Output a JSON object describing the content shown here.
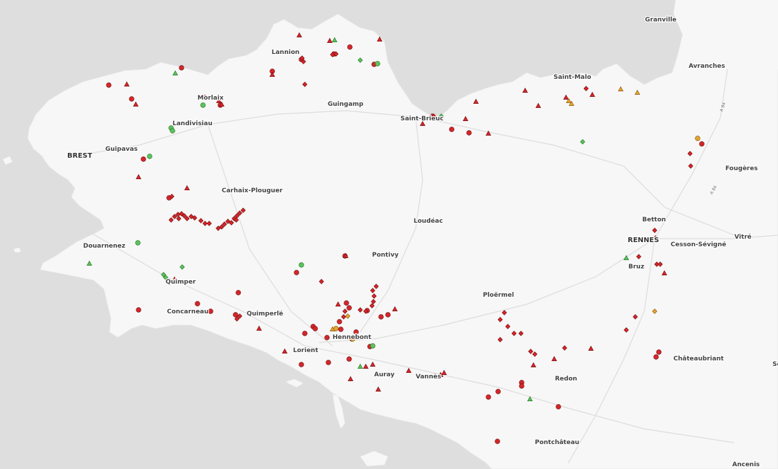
{
  "map": {
    "colors": {
      "sea": "#dedede",
      "land": "#f7f7f7",
      "marker_red": "#d7262b",
      "marker_green": "#5cc35c",
      "marker_orange": "#e6a632",
      "marker_stroke": "#7a1010"
    },
    "places": [
      {
        "name": "Granville",
        "big": false
      },
      {
        "name": "Avranches",
        "big": false
      },
      {
        "name": "Lannion",
        "big": false
      },
      {
        "name": "Saint-Malo",
        "big": false
      },
      {
        "name": "Morlaix",
        "big": false
      },
      {
        "name": "Guingamp",
        "big": false
      },
      {
        "name": "Landivisiau",
        "big": false
      },
      {
        "name": "Saint-Brieuc",
        "big": false
      },
      {
        "name": "BREST",
        "big": true
      },
      {
        "name": "Guipavas",
        "big": false
      },
      {
        "name": "Fougères",
        "big": false
      },
      {
        "name": "Carhaix-Plouguer",
        "big": false
      },
      {
        "name": "Loudéac",
        "big": false
      },
      {
        "name": "Betton",
        "big": false
      },
      {
        "name": "RENNES",
        "big": true
      },
      {
        "name": "Cesson-Sévigné",
        "big": false
      },
      {
        "name": "Vitré",
        "big": false
      },
      {
        "name": "Douarnenez",
        "big": false
      },
      {
        "name": "Pontivy",
        "big": false
      },
      {
        "name": "Bruz",
        "big": false
      },
      {
        "name": "Quimper",
        "big": false
      },
      {
        "name": "Ploërmel",
        "big": false
      },
      {
        "name": "Concarneau",
        "big": false
      },
      {
        "name": "Quimperlé",
        "big": false
      },
      {
        "name": "Hennebont",
        "big": false
      },
      {
        "name": "Lorient",
        "big": false
      },
      {
        "name": "Châteaubriant",
        "big": false
      },
      {
        "name": "Auray",
        "big": false
      },
      {
        "name": "Vannes",
        "big": false
      },
      {
        "name": "Redon",
        "big": false
      },
      {
        "name": "Pontchâteau",
        "big": false
      },
      {
        "name": "Ancenis",
        "big": false
      },
      {
        "name": "Se",
        "big": false
      }
    ],
    "road_labels": [
      "A 84",
      "A 84"
    ],
    "markers": {
      "red_circles": 48,
      "red_diamonds": 62,
      "red_triangles": 36,
      "green_markers": 20,
      "orange_markers": 11
    }
  }
}
